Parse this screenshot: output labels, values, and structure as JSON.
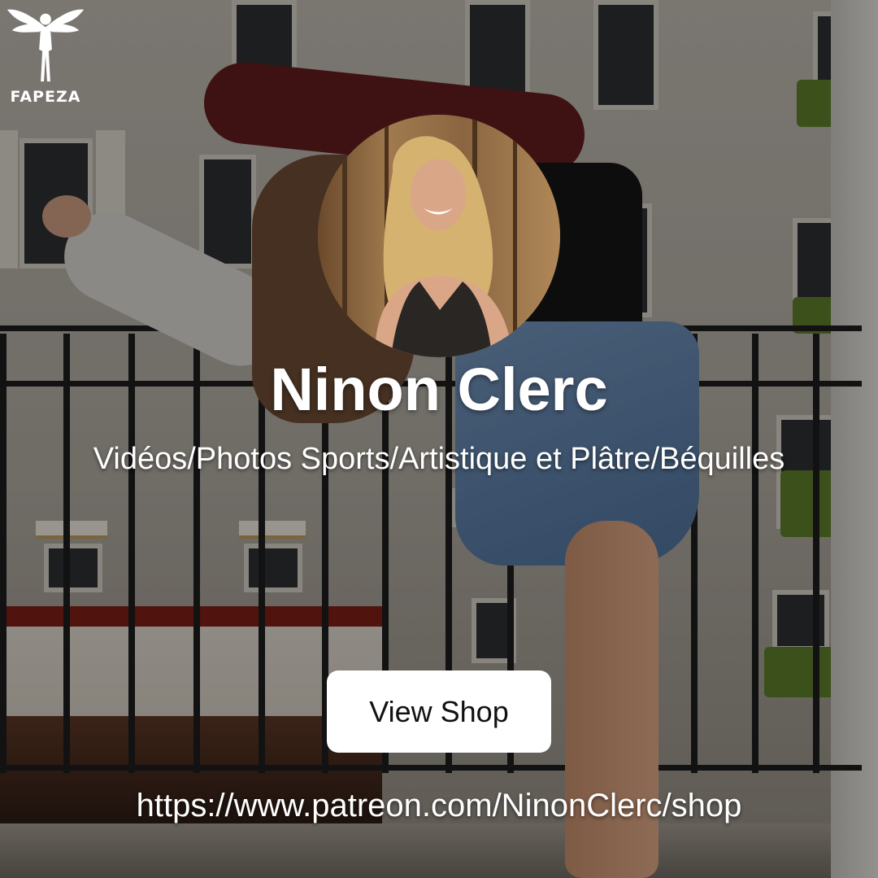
{
  "brand": {
    "logo_text": "FAPEZA",
    "icon": "winged-figure-icon"
  },
  "profile": {
    "name": "Ninon Clerc",
    "description": "Vidéos/Photos Sports/Artistique et Plâtre/Béquilles",
    "avatar_icon": "profile-photo"
  },
  "actions": {
    "view_shop_label": "View Shop",
    "shop_url": "https://www.patreon.com/NinonClerc/shop"
  },
  "colors": {
    "text": "#ffffff",
    "button_bg": "#ffffff",
    "button_text": "#111111",
    "overlay": "#000000"
  }
}
